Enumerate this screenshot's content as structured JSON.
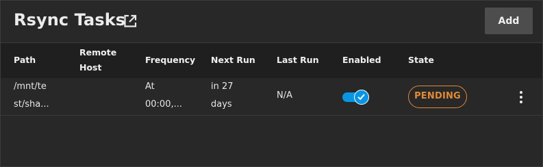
{
  "header": {
    "title": "Rsync Tasks",
    "add_label": "Add"
  },
  "table": {
    "columns": [
      "Path",
      "Remote Host",
      "Frequency",
      "Next Run",
      "Last Run",
      "Enabled",
      "State"
    ],
    "rows": [
      {
        "path": [
          "/mnt/te",
          "st/sha..."
        ],
        "remote_host": "",
        "frequency": [
          "At",
          "00:00,..."
        ],
        "next_run": [
          "in 27",
          "days"
        ],
        "last_run": "N/A",
        "enabled": true,
        "state": "PENDING"
      }
    ]
  },
  "colors": {
    "background": "#282828",
    "header_row": "#1f1f1f",
    "accent": "#0a95e3",
    "pending": "#e28a35",
    "add_button": "#4d4d4d"
  },
  "icons": {
    "title_link": "open-in-new-icon",
    "toggle_check": "check-icon",
    "row_menu": "more-vert-icon"
  }
}
